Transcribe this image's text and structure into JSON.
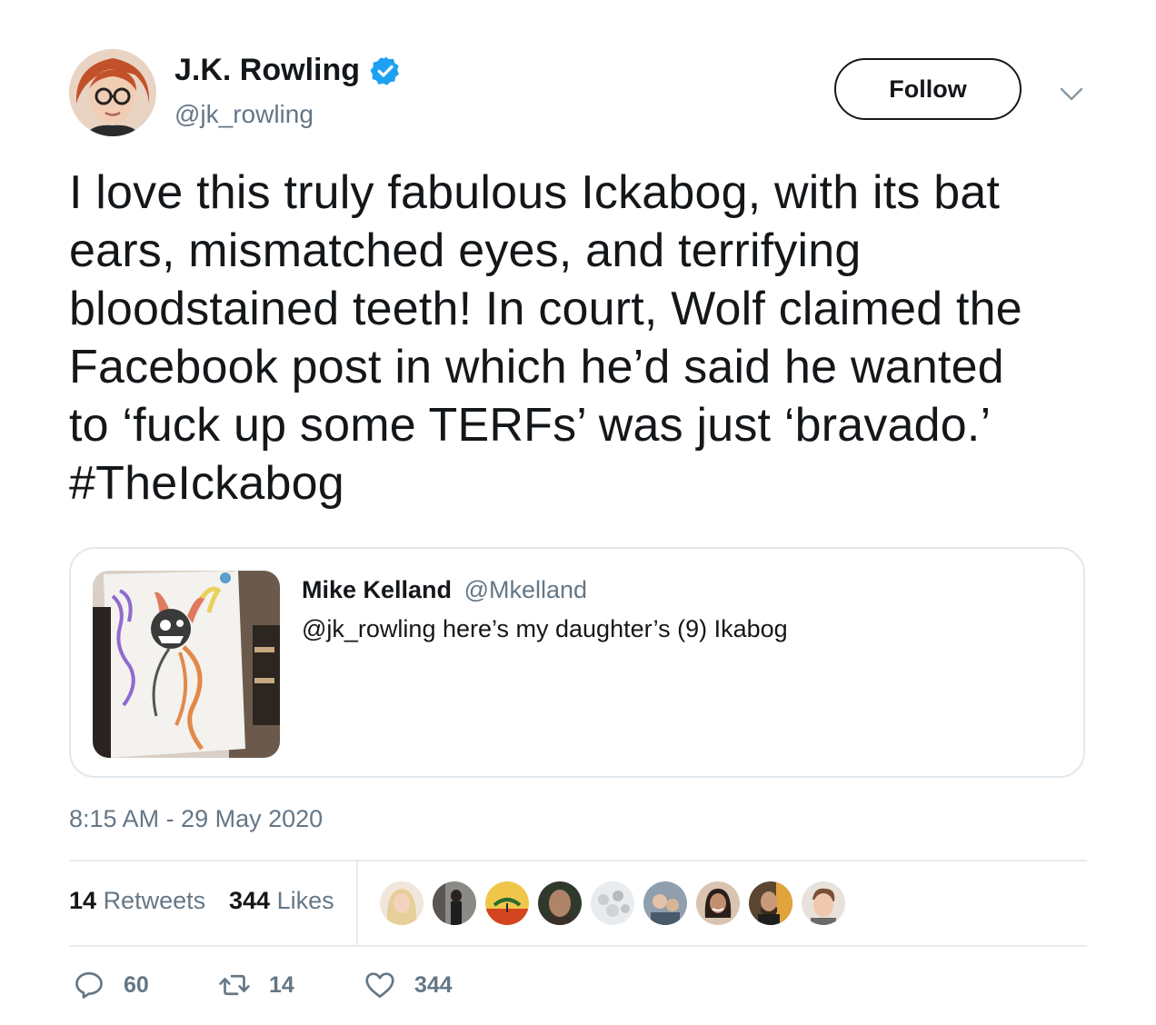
{
  "author": {
    "name": "J.K. Rowling",
    "handle": "@jk_rowling",
    "verified": true,
    "verified_icon": "verified-badge-icon"
  },
  "follow_label": "Follow",
  "tweet_lines": [
    "I love this truly fabulous Ickabog, with its bat",
    "ears, mismatched eyes, and terrifying",
    "bloodstained teeth! In court, Wolf claimed the",
    "Facebook post in which he’d said he wanted",
    "to ‘fuck up some TERFs’ was just ‘bravado.’",
    "#TheIckabog"
  ],
  "quote": {
    "name": "Mike Kelland",
    "handle": "@Mkelland",
    "text": "@jk_rowling here’s my daughter’s (9) Ikabog"
  },
  "timestamp": "8:15 AM - 29 May 2020",
  "stats": {
    "retweets_count": "14",
    "retweets_label": "Retweets",
    "likes_count": "344",
    "likes_label": "Likes"
  },
  "actions": {
    "replies": "60",
    "retweets": "14",
    "likes": "344"
  },
  "colors": {
    "text": "#14171a",
    "secondary": "#657786",
    "verified": "#1da1f2",
    "border": "#e1e8ed"
  }
}
